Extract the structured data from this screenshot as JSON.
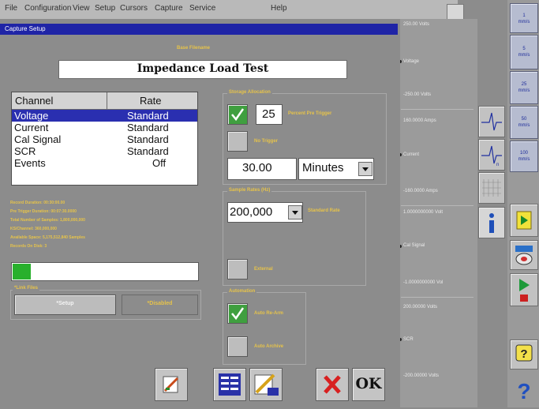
{
  "menubar": {
    "items": [
      "File",
      "Configuration",
      "View",
      "Setup",
      "Cursors",
      "Capture",
      "Service",
      "",
      "Help"
    ]
  },
  "dialog": {
    "title": "Capture Setup",
    "base_filename_label": "Base Filename",
    "base_filename_value": "Impedance Load Test"
  },
  "channel_table": {
    "col_channel": "Channel",
    "col_rate": "Rate",
    "rows": [
      {
        "channel": "Voltage",
        "rate": "Standard",
        "selected": true
      },
      {
        "channel": "Current",
        "rate": "Standard",
        "selected": false
      },
      {
        "channel": "Cal Signal",
        "rate": "Standard",
        "selected": false
      },
      {
        "channel": "SCR",
        "rate": "Standard",
        "selected": false
      },
      {
        "channel": "Events",
        "rate": "Off",
        "selected": false
      }
    ]
  },
  "stats": [
    "Record Duration: 00:30:00.00",
    "Pre Trigger Duration: 00:07:30.0000",
    "Total Number of Samples: 1,800,000,000",
    "KS/Channel: 360,000,000",
    "Available Space: 5,175,512,840 Samples",
    "Records On Disk: 3"
  ],
  "progress_fraction": 0.1,
  "link_files": {
    "label": "*Link Files",
    "setup_label": "*Setup",
    "disabled_label": "*Disabled"
  },
  "storage_allocation": {
    "label": "Storage Allocation",
    "percent_value": "25",
    "percent_label": "Percent Pre Trigger",
    "percent_checked": true,
    "no_trigger_label": "No Trigger",
    "no_trigger_checked": false,
    "duration_value": "30.00",
    "duration_unit": "Minutes"
  },
  "sample_rates": {
    "label": "Sample Rates (Hz)",
    "rate_value": "200,000",
    "standard_label": "Standard Rate",
    "external_label": "External",
    "external_checked": false
  },
  "automation": {
    "label": "Automation",
    "auto_rearm_label": "Auto Re-Arm",
    "auto_rearm_checked": true,
    "auto_archive_label": "Auto Archive",
    "auto_archive_checked": false
  },
  "bottom_buttons": {
    "ok_label": "OK"
  },
  "graphs": [
    {
      "top": "250.00 Volts",
      "name": "Voltage",
      "bottom": "-250.00 Volts"
    },
    {
      "top": "160.0000 Amps",
      "name": "Current",
      "bottom": "-160.0000 Amps"
    },
    {
      "top": "1.0000000000 Volt",
      "name": "Cal Signal",
      "bottom": "-1.0000000000 Vol"
    },
    {
      "top": "200.00000 Volts",
      "name": "SCR",
      "bottom": "-200.00000 Volts"
    }
  ],
  "right_buttons": [
    {
      "line1": "1",
      "line2": "mm/s"
    },
    {
      "line1": "5",
      "line2": "mm/s"
    },
    {
      "line1": "25",
      "line2": "mm/s"
    },
    {
      "line1": "50",
      "line2": "mm/s"
    },
    {
      "line1": "100",
      "line2": "mm/s"
    }
  ],
  "colors": {
    "titlebar": "#1f24a6",
    "label_gold": "#e6c34a",
    "selected_row": "#2a2fb0",
    "check_on": "#3f9f3f",
    "progress": "#28b02c"
  },
  "icons": [
    "trigger-icon",
    "trigger-n-icon",
    "grid-icon",
    "info-icon",
    "arrow-right-icon",
    "clock-icon",
    "play-stop-icon",
    "help-icon",
    "question-icon",
    "edit-icon",
    "list-icon",
    "pencil-list-icon",
    "cancel-x-icon"
  ]
}
